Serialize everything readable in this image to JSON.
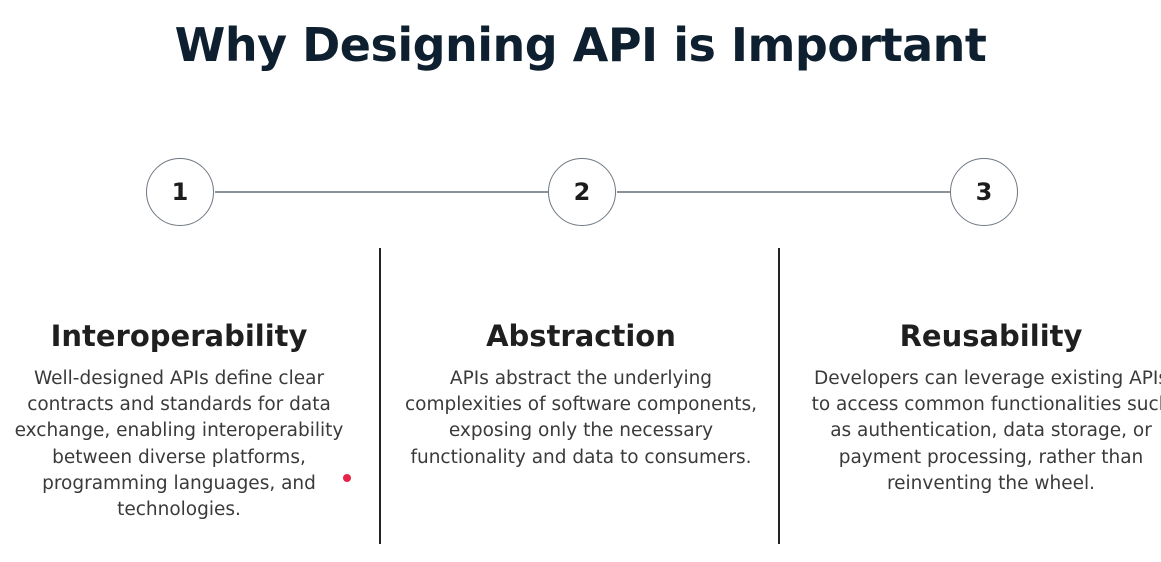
{
  "title": "Why Designing API is Important",
  "steps": [
    {
      "number": "1",
      "heading": "Interoperability",
      "description": "Well-designed APIs define clear contracts and standards for data exchange, enabling interoperability between diverse platforms, programming languages, and technologies."
    },
    {
      "number": "2",
      "heading": "Abstraction",
      "description": "APIs abstract the underlying complexities of software components, exposing only the necessary functionality and data to consumers."
    },
    {
      "number": "3",
      "heading": "Reusability",
      "description": "Developers can leverage existing APIs to access common functionalities such as authentication, data storage, or payment processing, rather than reinventing the wheel."
    }
  ],
  "colors": {
    "title": "#0e2030",
    "line": "#8a929a",
    "circle_border": "#6f7882",
    "divider": "#222222",
    "accent_dot": "#e8234a"
  }
}
